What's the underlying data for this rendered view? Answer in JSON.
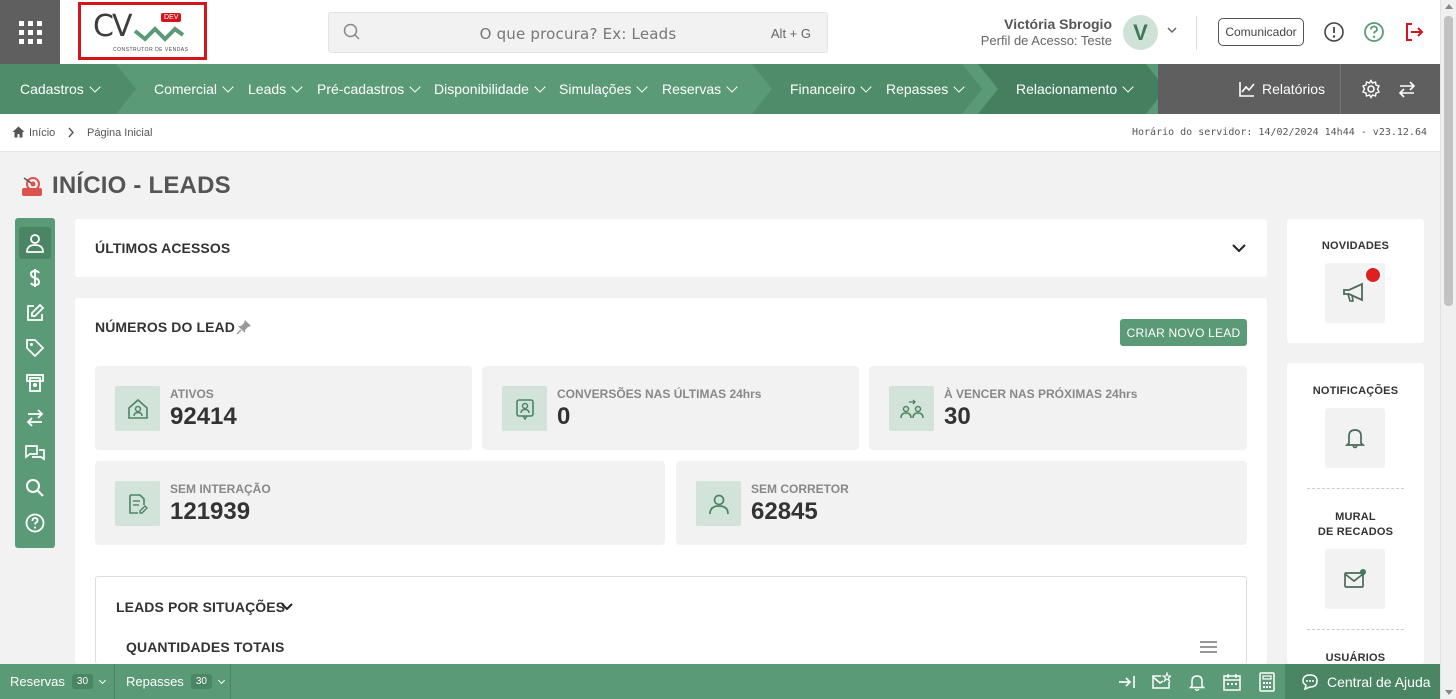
{
  "header": {
    "logo": {
      "text": "CV",
      "badge": "DEV",
      "tagline": "CONSTRUTOR DE VENDAS"
    },
    "search": {
      "placeholder": "O que procura? Ex: Leads",
      "shortcut": "Alt + G"
    },
    "user": {
      "name": "Victória Sbrogio",
      "profile": "Perfil de Acesso: Teste",
      "initial": "V"
    },
    "comunicador": "Comunicador"
  },
  "nav": {
    "items": [
      {
        "label": "Cadastros"
      },
      {
        "label": "Comercial"
      },
      {
        "label": "Leads"
      },
      {
        "label": "Pré-cadastros"
      },
      {
        "label": "Disponibilidade"
      },
      {
        "label": "Simulações"
      },
      {
        "label": "Reservas"
      },
      {
        "label": "Financeiro"
      },
      {
        "label": "Repasses"
      },
      {
        "label": "Relacionamento"
      }
    ],
    "reports": "Relatórios"
  },
  "breadcrumb": {
    "home": "Início",
    "current": "Página Inicial",
    "server_time": "Horário do servidor: 14/02/2024 14h44 - v23.12.64"
  },
  "page": {
    "title": "INÍCIO - LEADS"
  },
  "ultimos_acessos": {
    "title": "ÚLTIMOS ACESSOS"
  },
  "numeros": {
    "title": "NÚMEROS DO LEAD",
    "new_button": "CRIAR NOVO LEAD",
    "stats": [
      {
        "label": "ATIVOS",
        "value": "92414"
      },
      {
        "label": "CONVERSÕES NAS ÚLTIMAS 24hrs",
        "value": "0"
      },
      {
        "label": "À VENCER NAS PRÓXIMAS 24hrs",
        "value": "30"
      },
      {
        "label": "SEM INTERAÇÃO",
        "value": "121939"
      },
      {
        "label": "SEM CORRETOR",
        "value": "62845"
      }
    ]
  },
  "situacoes": {
    "title": "LEADS POR SITUAÇÕES",
    "subtitle": "QUANTIDADES TOTAIS"
  },
  "side": {
    "novidades": "NOVIDADES",
    "notificacoes": "NOTIFICAÇÕES",
    "mural_line1": "MURAL",
    "mural_line2": "DE RECADOS",
    "usuarios": "USUÁRIOS"
  },
  "footer": {
    "reservas": {
      "label": "Reservas",
      "count": "30"
    },
    "repasses": {
      "label": "Repasses",
      "count": "30"
    },
    "help": "Central de Ajuda"
  },
  "colors": {
    "primary": "#5b9a76",
    "dark": "#5f5f5f",
    "danger": "#d4161c"
  }
}
